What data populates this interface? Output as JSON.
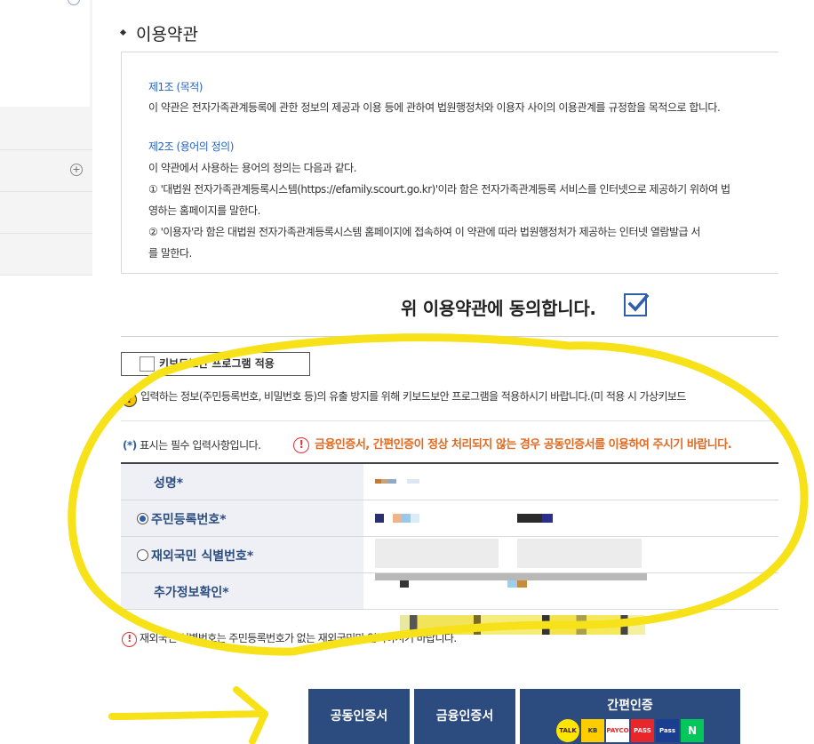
{
  "section": {
    "title": "이용약관"
  },
  "terms": {
    "art1_title": "제1조 (목적)",
    "art1_text": "이 약관은 전자가족관계등록에 관한 정보의 제공과 이용 등에 관하여 법원행정처와 이용자 사이의 이용관계를 규정함을 목적으로 합니다.",
    "art2_title": "제2조 (용어의 정의)",
    "art2_l1": "이 약관에서 사용하는 용어의 정의는 다음과 같다.",
    "art2_l2": "① '대법원 전자가족관계등록시스템(https://efamily.scourt.go.kr)'이라 함은 전자가족관계등록 서비스를 인터넷으로 제공하기 위하여 법",
    "art2_l3": "영하는 홈페이지를 말한다.",
    "art2_l4": "② '이용자'라 함은 대법원 전자가족관계등록시스템 홈페이지에 접속하여 이 약관에 따라 법원행정처가 제공하는 인터넷 열람발급 서",
    "art2_l5": "를 말한다."
  },
  "agree": {
    "label": "위 이용약관에 동의합니다.",
    "checked": true
  },
  "keyboard_security": {
    "label": "키보드보안 프로그램 적용",
    "checked": false
  },
  "notice_keyboard": "입력하는 정보(주민등록번호, 비밀번호 등)의 유출 방지를 위해 키보드보안 프로그램을 적용하시기 바랍니다.(미 적용 시 가상키보드",
  "required_note": {
    "star": "(*)",
    "text": " 표시는 필수 입력사항입니다."
  },
  "warning_text": "금융인증서, 간편인증이 정상 처리되지 않는 경우 공동인증서를 이용하여 주시기 바랍니다.",
  "form": {
    "name_label": "성명",
    "rrn_label": "주민등록번호",
    "foreign_label": "재외국민 식별번호",
    "extra_label": "추가정보확인",
    "star": "*"
  },
  "notice_foreign": "재외국민 식별번호는 주민등록번호가 없는 재외국민만 입력하시기 바랍니다.",
  "auth": {
    "joint_cert": "공동인증서",
    "financial_cert": "금융인증서",
    "easy_auth": "간편인증",
    "providers": [
      "TALK",
      "KB",
      "PAYCO",
      "PASS",
      "Pass",
      "N"
    ]
  },
  "colors": {
    "primary": "#2c4b7e",
    "link_blue": "#2763c4",
    "warning_orange": "#e06a22",
    "annotation_yellow": "#f7e21a"
  }
}
